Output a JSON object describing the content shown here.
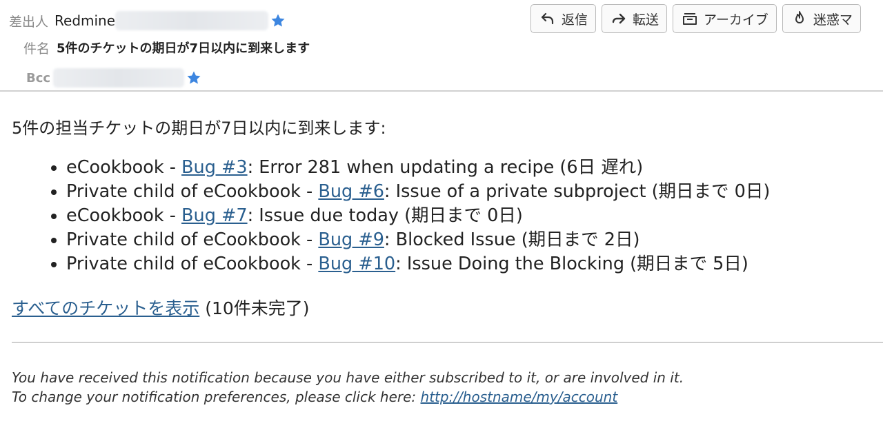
{
  "header": {
    "from_label": "差出人",
    "from_name": "Redmine",
    "subject_label": "件名",
    "subject": "5件のチケットの期日が7日以内に到来します",
    "bcc_label": "Bcc"
  },
  "toolbar": {
    "reply": "返信",
    "forward": "転送",
    "archive": "アーカイブ",
    "junk": "迷惑マ"
  },
  "body": {
    "intro": "5件の担当チケットの期日が7日以内に到来します:",
    "issues": [
      {
        "project": "eCookbook - ",
        "link": "Bug #3",
        "text": ": Error 281 when updating a recipe (6日 遅れ)"
      },
      {
        "project": "Private child of eCookbook - ",
        "link": "Bug #6",
        "text": ": Issue of a private subproject (期日まで 0日)"
      },
      {
        "project": "eCookbook - ",
        "link": "Bug #7",
        "text": ": Issue due today (期日まで 0日)"
      },
      {
        "project": "Private child of eCookbook - ",
        "link": "Bug #9",
        "text": ": Blocked Issue (期日まで 2日)"
      },
      {
        "project": "Private child of eCookbook - ",
        "link": "Bug #10",
        "text": ": Issue Doing the Blocking (期日まで 5日)"
      }
    ],
    "view_all_link": "すべてのチケットを表示",
    "view_all_count": " (10件未完了)"
  },
  "footer": {
    "line1": "You have received this notification because you have either subscribed to it, or are involved in it.",
    "line2_prefix": "To change your notification preferences, please click here: ",
    "line2_link": "http://hostname/my/account"
  },
  "colors": {
    "link": "#2a5f8f",
    "star": "#3d86e0",
    "label": "#8a8a8a"
  }
}
